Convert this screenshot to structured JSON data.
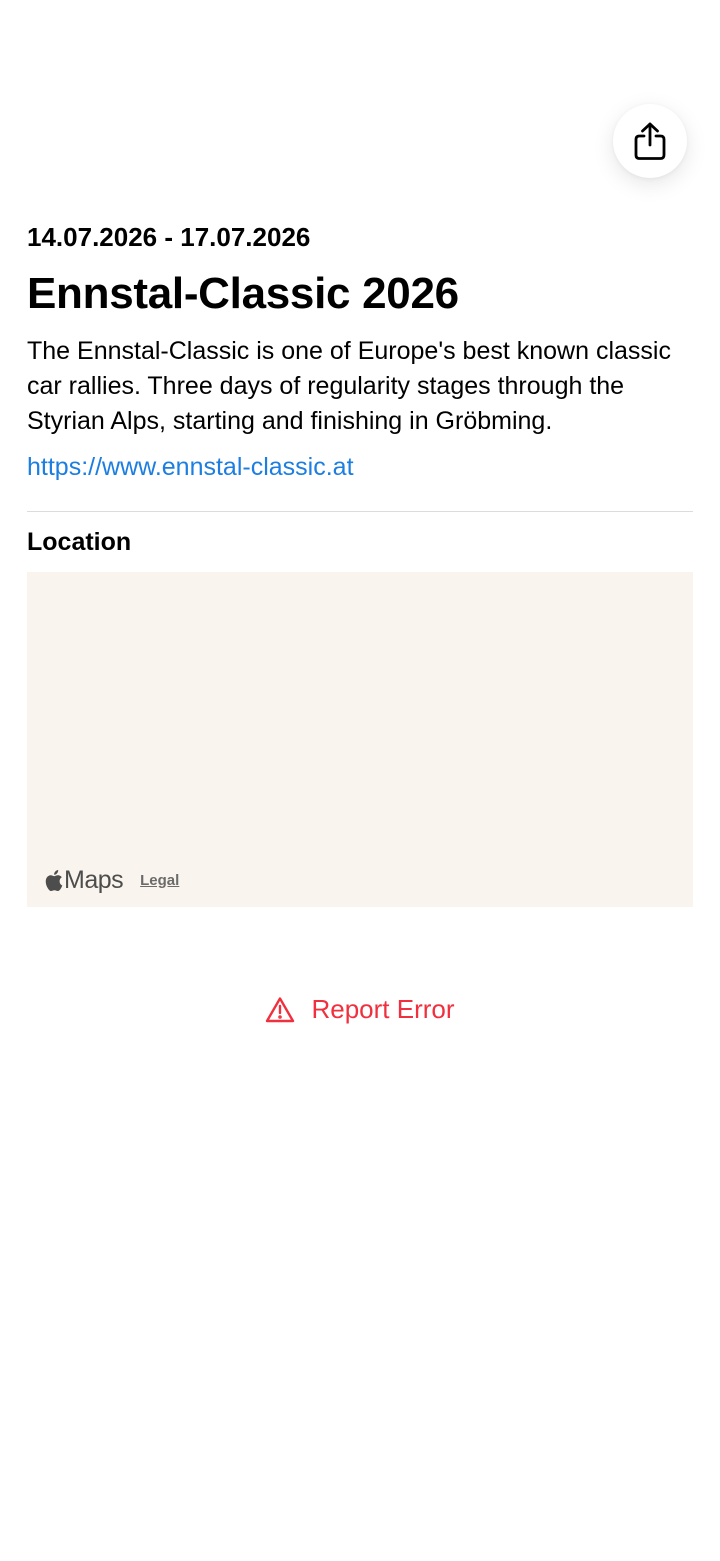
{
  "event": {
    "dates": "14.07.2026 - 17.07.2026",
    "title": "Ennstal-Classic 2026",
    "description": "The Ennstal-Classic is one of Europe's best known classic car rallies. Three days of regularity stages through the Styrian Alps, starting and finishing in Gröbming.",
    "website": "https://www.ennstal-classic.at"
  },
  "location": {
    "section_title": "Location",
    "map": {
      "provider_label": "Maps",
      "legal_label": "Legal"
    }
  },
  "actions": {
    "share_icon": "share-icon",
    "report_label": "Report Error",
    "report_icon": "warning-triangle-icon"
  },
  "colors": {
    "link": "#1c7ee0",
    "destructive": "#f0303e",
    "map_background": "#f9f4ed",
    "divider": "#dcdcdc"
  }
}
